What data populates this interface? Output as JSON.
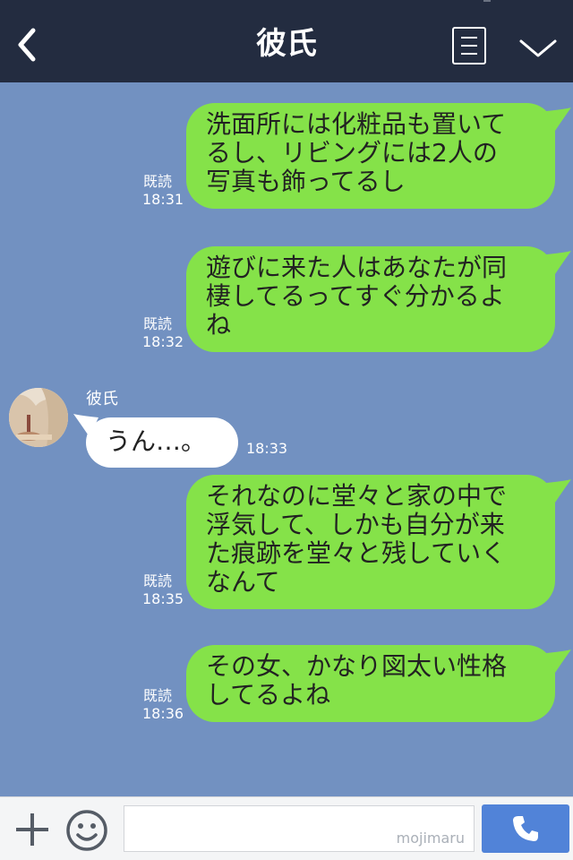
{
  "header": {
    "title": "彼氏",
    "back_icon": "chevron-left-icon",
    "menu_icon": "list-icon",
    "expand_icon": "chevron-down-icon"
  },
  "messages": [
    {
      "text": "洗面所には化粧品も置いて\nるし、リビングには2人の\n写真も飾ってるし",
      "read": "既読",
      "time": "18:31"
    },
    {
      "text": "遊びに来た人はあなたが同\n棲してるってすぐ分かるよ\nね",
      "read": "既読",
      "time": "18:32"
    },
    {
      "text": "それなのに堂々と家の中で\n浮気して、しかも自分が来\nた痕跡を堂々と残していく\nなんて",
      "read": "既読",
      "time": "18:35"
    },
    {
      "text": "その女、かなり図太い性格\nしてるよね",
      "read": "既読",
      "time": "18:36"
    }
  ],
  "incoming": {
    "sender": "彼氏",
    "text": "うん…。",
    "time": "18:33"
  },
  "input": {
    "watermark": "mojimaru",
    "placeholder": ""
  },
  "colors": {
    "header_bg": "#232c40",
    "chat_bg": "#7291c1",
    "bubble_out": "#85e249",
    "bubble_in": "#ffffff",
    "send_button": "#5183d8"
  }
}
